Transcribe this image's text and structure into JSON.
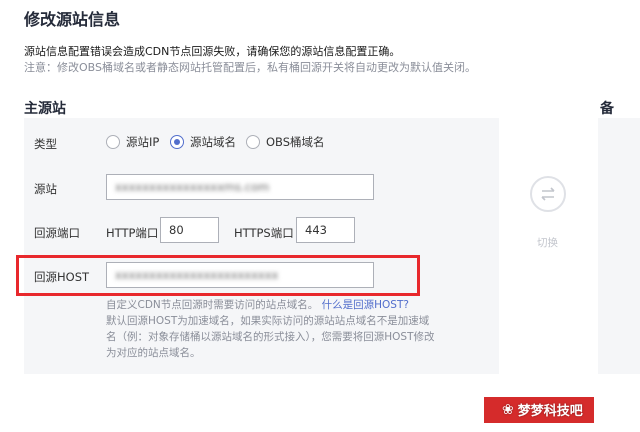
{
  "page_title": "修改源站信息",
  "notice": {
    "line1": "源站信息配置错误会造成CDN节点回源失败，请确保您的源站信息配置正确。",
    "line2": "注意：修改OBS桶域名或者静态网站托管配置后，私有桶回源开关将自动更改为默认值关闭。"
  },
  "primary_section": {
    "title": "主源站"
  },
  "backup_section": {
    "title": "备"
  },
  "form": {
    "type_label": "类型",
    "type_options": [
      {
        "label": "源站IP",
        "checked": false
      },
      {
        "label": "源站域名",
        "checked": true
      },
      {
        "label": "OBS桶域名",
        "checked": false
      }
    ],
    "origin_label": "源站",
    "origin_value": "xxxxxxxxxxxxxxxxms.com",
    "port_label": "回源端口",
    "http_port_label": "HTTP端口",
    "http_port_value": "80",
    "https_port_label": "HTTPS端口",
    "https_port_value": "443",
    "host_label": "回源HOST",
    "host_value": "xxxxxxxxxxxxxxxxxxxxxxxx",
    "hint_line1": "自定义CDN节点回源时需要访问的站点域名。",
    "hint_link": "什么是回源HOST?",
    "hint_rest": "默认回源HOST为加速域名，如果实际访问的源站站点域名不是加速域名（例：对象存储桶以源站域名的形式接入），您需要将回源HOST修改为对应的站点域名。"
  },
  "switch_button": {
    "label": "切换",
    "icon": "swap-icon"
  },
  "watermark": {
    "text": "梦梦科技吧",
    "icon": "paw-icon"
  },
  "colors": {
    "accent": "#526ecc",
    "highlight": "#e8282c",
    "panel": "#f5f6f8"
  }
}
